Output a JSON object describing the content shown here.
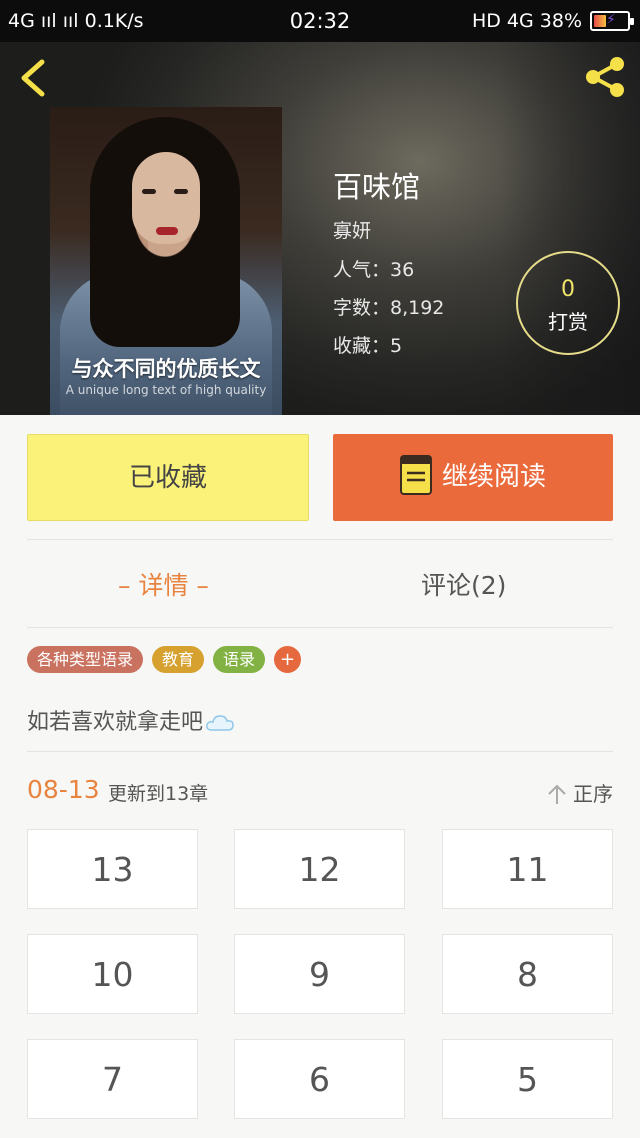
{
  "status_bar": {
    "left": "4G ııl  ııl 0.1K/s",
    "time": "02:32",
    "right": "HD 4G 38%",
    "battery_level": 0.38
  },
  "book": {
    "cover_title": "与众不同的优质长文",
    "cover_subtitle": "A unique long text of high quality",
    "title": "百味馆",
    "author": "寡妍",
    "popularity": "人气：36",
    "word_count": "字数：8,192",
    "favorites": "收藏：5"
  },
  "reward": {
    "count": "0",
    "label": "打赏"
  },
  "actions": {
    "favorited_label": "已收藏",
    "continue_label": "继续阅读"
  },
  "tabs": {
    "detail": "– 详情 –",
    "comments": "评论(2)"
  },
  "tags": [
    "各种类型语录",
    "教育",
    "语录",
    "+"
  ],
  "description": "如若喜欢就拿走吧",
  "update": {
    "date": "08-13",
    "text": "更新到13章",
    "sort_label": "正序"
  },
  "chapters": [
    "13",
    "12",
    "11",
    "10",
    "9",
    "8",
    "7",
    "6",
    "5"
  ],
  "colors": {
    "accent": "#e8843f",
    "read_button": "#ea6a3c",
    "fav_button": "#fbf27a",
    "icon_yellow": "#f5e04a"
  }
}
